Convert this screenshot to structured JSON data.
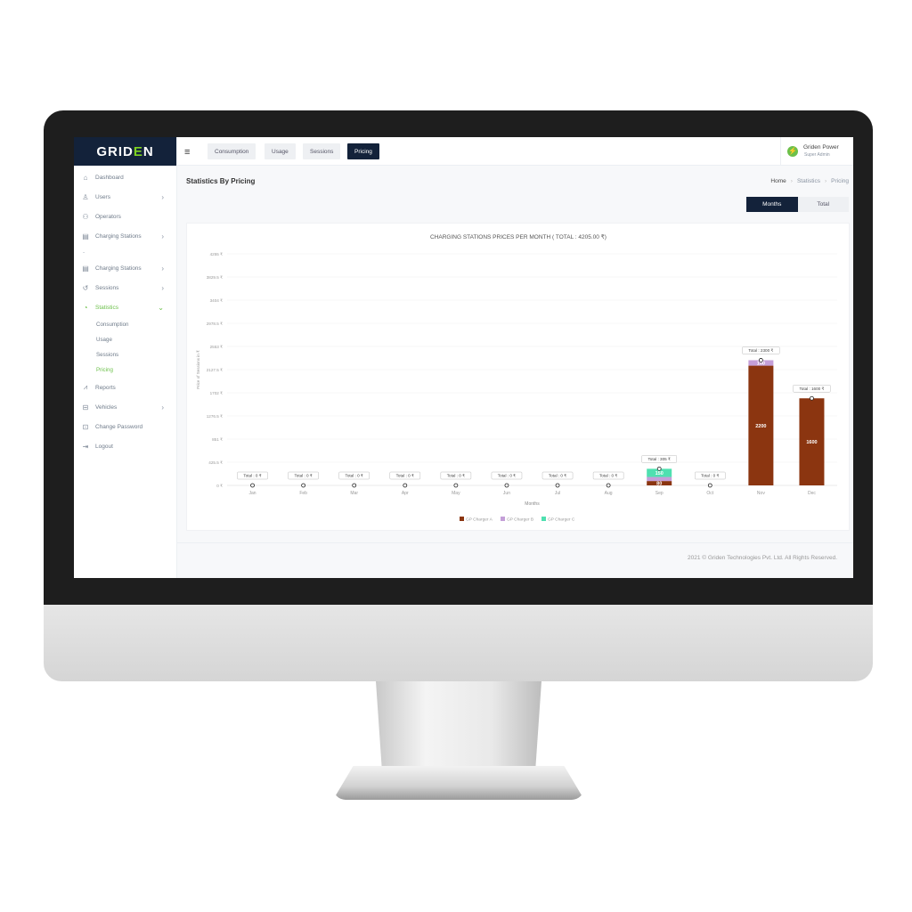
{
  "brand": {
    "logo_left": "GRID",
    "logo_accent": "E",
    "logo_right": "N"
  },
  "sidebar": {
    "items": [
      {
        "label": "Dashboard",
        "icon": "home-icon",
        "chev": ""
      },
      {
        "label": "Users",
        "icon": "user-icon",
        "chev": "›"
      },
      {
        "label": "Operators",
        "icon": "users-icon",
        "chev": ""
      },
      {
        "label": "Charging Stations",
        "icon": "station-icon",
        "chev": "›"
      }
    ],
    "dash": "-",
    "items2": [
      {
        "label": "Charging Stations",
        "icon": "station-icon",
        "chev": "›"
      },
      {
        "label": "Sessions",
        "icon": "history-icon",
        "chev": "›"
      },
      {
        "label": "Statistics",
        "icon": "pie-chart-icon",
        "chev": "⌄"
      }
    ],
    "sub_items": [
      "Consumption",
      "Usage",
      "Sessions",
      "Pricing"
    ],
    "items3": [
      {
        "label": "Reports",
        "icon": "trend-icon",
        "chev": ""
      },
      {
        "label": "Vehicles",
        "icon": "car-icon",
        "chev": "›"
      },
      {
        "label": "Change Password",
        "icon": "lock-icon",
        "chev": ""
      },
      {
        "label": "Logout",
        "icon": "logout-icon",
        "chev": ""
      }
    ]
  },
  "topbar": {
    "tabs": [
      "Consumption",
      "Usage",
      "Sessions",
      "Pricing"
    ],
    "selected_tab": "Pricing",
    "user_name": "Griden Power",
    "user_role": "Super Admin"
  },
  "page": {
    "title": "Statistics By Pricing",
    "breadcrumb": [
      "Home",
      "Statistics",
      "Pricing"
    ],
    "toggle": [
      "Months",
      "Total"
    ]
  },
  "chart_data": {
    "type": "bar",
    "stacked": true,
    "title": "CHARGING STATIONS PRICES PER MONTH ( TOTAL : 4205.00 ₹)",
    "xlabel": "Months",
    "ylabel": "Price of Sessions in ₹",
    "y_ticks": [
      "0 ₹",
      "425.5 ₹",
      "851 ₹",
      "1276.5 ₹",
      "1702 ₹",
      "2127.5 ₹",
      "2553 ₹",
      "2978.5 ₹",
      "3404 ₹",
      "3829.5 ₹",
      "4255 ₹"
    ],
    "ylim": [
      0,
      4255
    ],
    "categories": [
      "Jan",
      "Feb",
      "Mar",
      "Apr",
      "May",
      "Jun",
      "Jul",
      "Aug",
      "Sep",
      "Oct",
      "Nov",
      "Dec"
    ],
    "series": [
      {
        "name": "GP Charger A",
        "color": "#8b3510",
        "values": [
          0,
          0,
          0,
          0,
          0,
          0,
          0,
          0,
          80,
          0,
          2200,
          1600
        ]
      },
      {
        "name": "GP Charger B",
        "color": "#c49fd8",
        "values": [
          0,
          0,
          0,
          0,
          0,
          0,
          0,
          0,
          75,
          0,
          100,
          0
        ]
      },
      {
        "name": "GP Charger C",
        "color": "#4fe0b0",
        "values": [
          0,
          0,
          0,
          0,
          0,
          0,
          0,
          0,
          150,
          0,
          0,
          0
        ]
      }
    ],
    "value_labels": {
      "Sep": [
        "80",
        "",
        "150"
      ],
      "Nov": [
        "2200",
        "100",
        ""
      ],
      "Dec": [
        "1600",
        "",
        ""
      ]
    },
    "totals": [
      "Total : 0 ₹",
      "Total : 0 ₹",
      "Total : 0 ₹",
      "Total : 0 ₹",
      "Total : 0 ₹",
      "Total : 0 ₹",
      "Total : 0 ₹",
      "Total : 0 ₹",
      "Total : 305 ₹",
      "Total : 0 ₹",
      "Total : 2300 ₹",
      "Total : 1600 ₹"
    ],
    "legend_position": "bottom",
    "grid": true
  },
  "footer": {
    "text": "2021 © Griden Technologies Pvt. Ltd. All Rights Reserved."
  }
}
